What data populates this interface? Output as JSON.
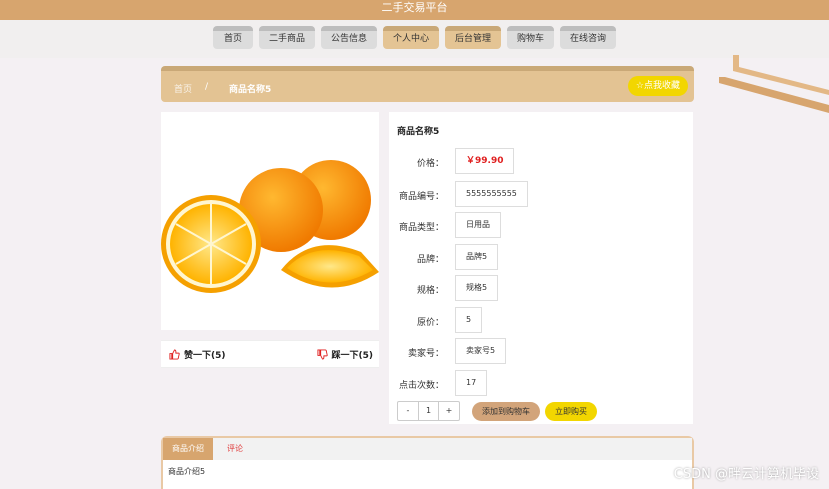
{
  "header": {
    "title": "二手交易平台"
  },
  "nav": [
    {
      "label": "首页"
    },
    {
      "label": "二手商品"
    },
    {
      "label": "公告信息"
    },
    {
      "label": "个人中心"
    },
    {
      "label": "后台管理"
    },
    {
      "label": "购物车"
    },
    {
      "label": "在线咨询"
    }
  ],
  "breadcrumb": {
    "home": "首页",
    "sep": "/",
    "current": "商品名称5"
  },
  "favorite_button": "☆点我收藏",
  "vote": {
    "up_label": "赞一下(5)",
    "down_label": "踩一下(5)"
  },
  "product": {
    "name": "商品名称5",
    "fields": [
      {
        "label": "价格：",
        "value": "￥99.90"
      },
      {
        "label": "商品编号：",
        "value": "5555555555"
      },
      {
        "label": "商品类型：",
        "value": "日用品"
      },
      {
        "label": "品牌：",
        "value": "品牌5"
      },
      {
        "label": "规格：",
        "value": "规格5"
      },
      {
        "label": "原价：",
        "value": "5"
      },
      {
        "label": "卖家号：",
        "value": "卖家号5"
      },
      {
        "label": "点击次数：",
        "value": "17"
      }
    ]
  },
  "quantity": {
    "minus": "-",
    "value": "1",
    "plus": "+"
  },
  "actions": {
    "add_to_cart": "添加到购物车",
    "buy_now": "立即购买"
  },
  "tabs": {
    "intro": "商品介绍",
    "comments": "评论",
    "content": "商品介绍5"
  },
  "watermark": "CSDN @畔云计算机毕设",
  "colors": {
    "brand": "#d7a56e",
    "accent": "#f2d600",
    "price": "#e02020"
  }
}
